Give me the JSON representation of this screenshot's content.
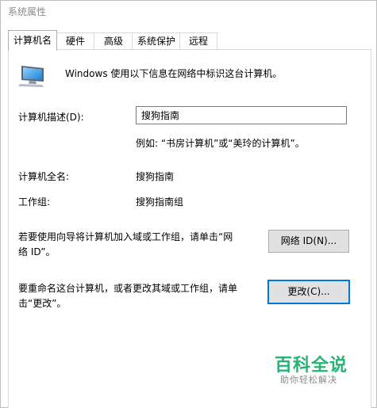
{
  "window": {
    "title": "系统属性"
  },
  "tabs": [
    {
      "label": "计算机名",
      "active": true
    },
    {
      "label": "硬件"
    },
    {
      "label": "高级"
    },
    {
      "label": "系统保护"
    },
    {
      "label": "远程"
    }
  ],
  "panel": {
    "intro": "Windows 使用以下信息在网络中标识这台计算机。",
    "description_label": "计算机描述(D):",
    "description_value": "搜狗指南",
    "example": "例如: “书房计算机”或“美玲的计算机”。",
    "fullname_label": "计算机全名:",
    "fullname_value": "搜狗指南",
    "workgroup_label": "工作组:",
    "workgroup_value": "搜狗指南组",
    "network_id_text": "若要使用向导将计算机加入域或工作组，请单击“网络 ID”。",
    "network_id_button": "网络 ID(N)...",
    "rename_text": "要重命名这台计算机，或者更改其域或工作组，请单击“更改”。",
    "change_button": "更改(C)..."
  },
  "watermark": {
    "title": "百科全说",
    "subtitle": "助你轻松解决"
  },
  "colors": {
    "focus": "#0078d7",
    "watermark": "#22b573"
  }
}
